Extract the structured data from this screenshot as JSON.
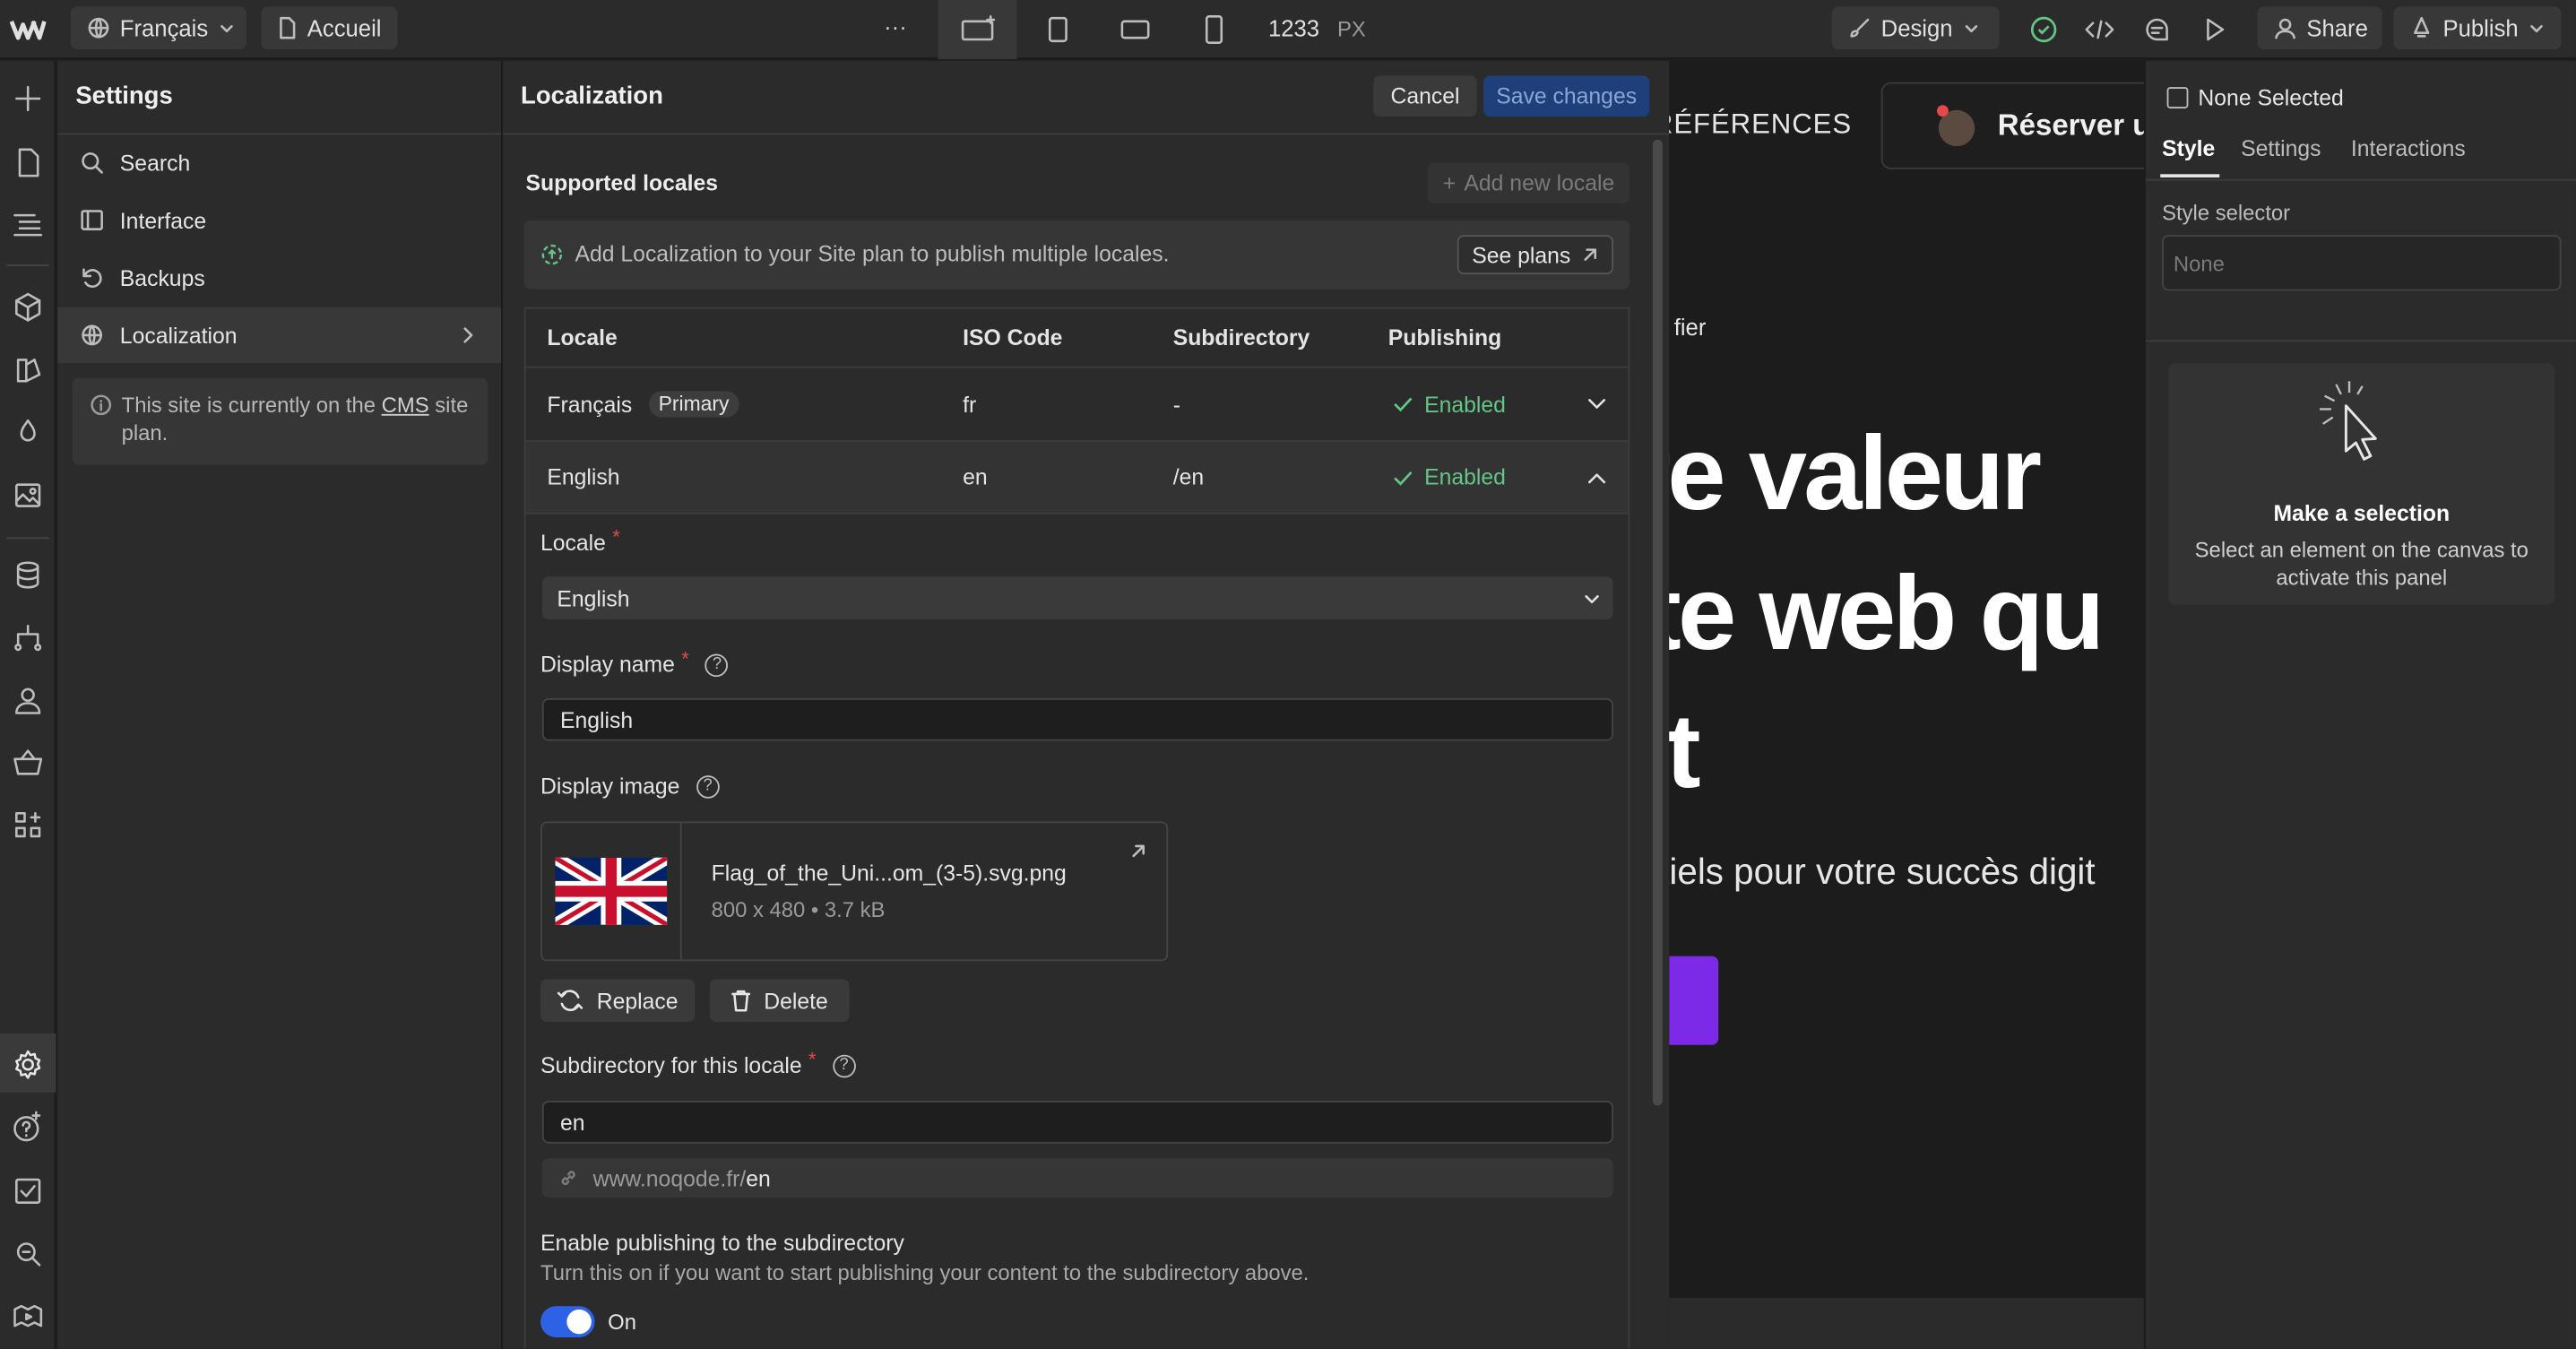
{
  "topbar": {
    "language": "Français",
    "page": "Accueil",
    "more": "···",
    "width_value": "1233",
    "width_unit": "PX",
    "design_label": "Design",
    "share_label": "Share",
    "publish_label": "Publish"
  },
  "settings": {
    "title": "Settings",
    "nav": [
      {
        "label": "Search"
      },
      {
        "label": "Interface"
      },
      {
        "label": "Backups"
      },
      {
        "label": "Localization"
      }
    ],
    "info_prefix": "This site is currently on the ",
    "info_link": "CMS",
    "info_suffix": " site plan."
  },
  "localization": {
    "title": "Localization",
    "cancel_label": "Cancel",
    "save_label": "Save changes",
    "supported_title": "Supported locales",
    "add_locale_label": "Add new locale",
    "banner_text": "Add Localization to your Site plan to publish multiple locales.",
    "see_plans_label": "See plans",
    "columns": [
      "Locale",
      "ISO Code",
      "Subdirectory",
      "Publishing"
    ],
    "rows": [
      {
        "locale": "Français",
        "badge": "Primary",
        "iso": "fr",
        "subdir": "-",
        "publishing": "Enabled"
      },
      {
        "locale": "English",
        "badge": "",
        "iso": "en",
        "subdir": "/en",
        "publishing": "Enabled"
      }
    ],
    "form": {
      "locale_label": "Locale",
      "locale_value": "English",
      "display_name_label": "Display name",
      "display_name_value": "English",
      "display_image_label": "Display image",
      "image_filename": "Flag_of_the_Uni...om_(3-5).svg.png",
      "image_meta": "800 x 480 • 3.7 kB",
      "replace_label": "Replace",
      "delete_label": "Delete",
      "subdir_label": "Subdirectory for this locale",
      "subdir_value": "en",
      "url_base": "www.noqode.fr/",
      "url_suffix": "en",
      "publish_title": "Enable publishing to the subdirectory",
      "publish_desc": "Turn this on if you want to start publishing your content to the subdirectory above.",
      "toggle_label": "On"
    }
  },
  "canvas": {
    "nav_text": "RÉFÉRENCES",
    "cta_text": "Réserver u",
    "small_text": "fier",
    "headline_1": "re valeur",
    "headline_2": "te web qu",
    "headline_3": "t",
    "subtext": "tiels pour votre succès digit"
  },
  "right_panel": {
    "none_selected": "None Selected",
    "tabs": [
      "Style",
      "Settings",
      "Interactions"
    ],
    "style_selector_label": "Style selector",
    "style_selector_placeholder": "None",
    "empty_title": "Make a selection",
    "empty_desc": "Select an element on the canvas to activate this panel"
  },
  "colors": {
    "accent_blue": "#2d62e6",
    "enabled_green": "#63c687",
    "purple_button": "#7c2ae8"
  }
}
